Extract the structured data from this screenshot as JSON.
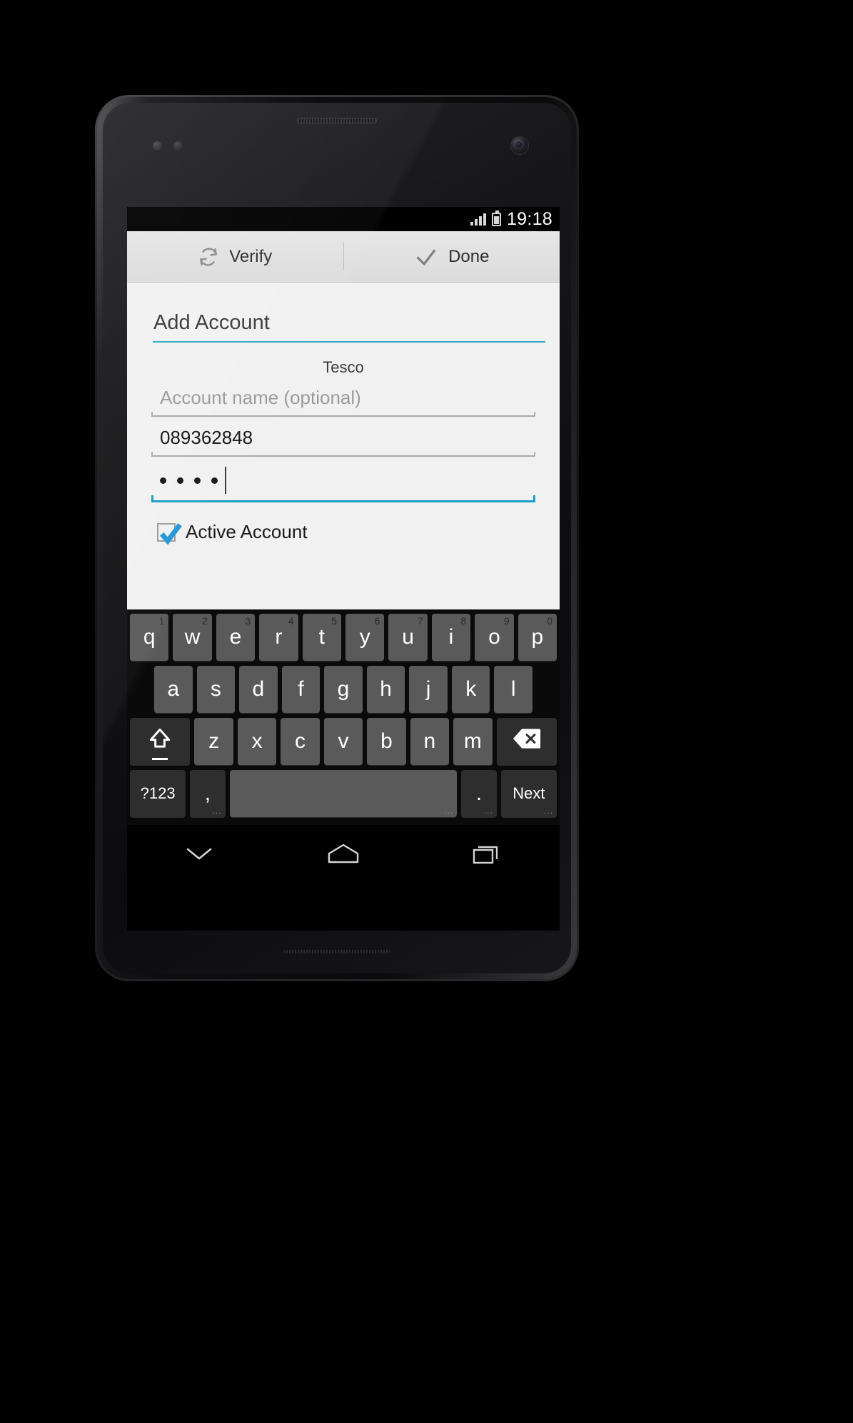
{
  "statusbar": {
    "time": "19:18",
    "signal_icon": "signal-bars-icon",
    "battery_icon": "battery-icon"
  },
  "actionbar": {
    "verify_label": "Verify",
    "verify_icon": "refresh-icon",
    "done_label": "Done",
    "done_icon": "checkmark-icon"
  },
  "form": {
    "title": "Add Account",
    "title_accent_color": "#30a7c4",
    "provider": "Tesco",
    "account_name_placeholder": "Account name (optional)",
    "account_name_value": "",
    "account_number_value": "089362848",
    "password_masked": "• • • •",
    "password_dot_count": 4,
    "focus_color": "#1a9cc4",
    "checkbox_label": "Active Account",
    "checkbox_checked": true,
    "checkbox_color": "#2196d4"
  },
  "keyboard": {
    "row1": [
      {
        "label": "q",
        "hint": "1"
      },
      {
        "label": "w",
        "hint": "2"
      },
      {
        "label": "e",
        "hint": "3"
      },
      {
        "label": "r",
        "hint": "4"
      },
      {
        "label": "t",
        "hint": "5"
      },
      {
        "label": "y",
        "hint": "6"
      },
      {
        "label": "u",
        "hint": "7"
      },
      {
        "label": "i",
        "hint": "8"
      },
      {
        "label": "o",
        "hint": "9"
      },
      {
        "label": "p",
        "hint": "0"
      }
    ],
    "row2": [
      {
        "label": "a"
      },
      {
        "label": "s"
      },
      {
        "label": "d"
      },
      {
        "label": "f"
      },
      {
        "label": "g"
      },
      {
        "label": "h"
      },
      {
        "label": "j"
      },
      {
        "label": "k"
      },
      {
        "label": "l"
      }
    ],
    "row3": [
      {
        "label": "z"
      },
      {
        "label": "x"
      },
      {
        "label": "c"
      },
      {
        "label": "v"
      },
      {
        "label": "b"
      },
      {
        "label": "n"
      },
      {
        "label": "m"
      }
    ],
    "shift_icon": "shift-arrow-icon",
    "delete_icon": "backspace-icon",
    "symbols_label": "?123",
    "comma_label": ",",
    "comma_mini": "...",
    "space_label": "",
    "space_mini": "...",
    "period_label": ".",
    "period_mini": "...",
    "next_label": "Next",
    "next_mini": "..."
  },
  "navbar": {
    "back_icon": "hide-keyboard-chevron-icon",
    "home_icon": "home-icon",
    "recents_icon": "recent-apps-icon"
  }
}
